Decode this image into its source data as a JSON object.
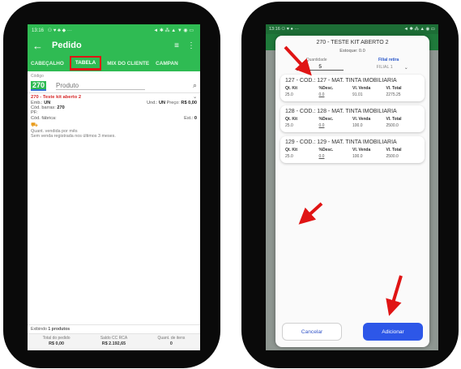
{
  "colors": {
    "accent": "#2fbb53",
    "highlight": "#e01414",
    "primary_button": "#2d57e8",
    "error_title": "#d62828",
    "arrow": "#e01414"
  },
  "left": {
    "status": {
      "time": "13:16",
      "icons": "⚇ ♥ ♣ ◆ ···",
      "right_icons": "◄ ✱ ⁂ ▲ ▼ ◉ ▭"
    },
    "appbar": {
      "title": "Pedido",
      "back_icon": "←",
      "filter_icon": "≡",
      "more_icon": "⋮"
    },
    "tabs": [
      "CABEÇALHO",
      "TABELA",
      "MIX DO CLIENTE",
      "CAMPAN"
    ],
    "search": {
      "label": "Código",
      "code": "270",
      "product_placeholder": "Produto"
    },
    "product": {
      "title": "270 - Teste kit aberto 2",
      "emb_label": "Emb.:",
      "emb_value": "UN",
      "und_label": "Und.:",
      "und_value": "UN",
      "preco_label": "Preço:",
      "preco_value": "R$ 0,00",
      "barras_label": "Cód. barras:",
      "barras_value": "270",
      "pf_label": "PF:",
      "fabrica_label": "Cód. fábrica:",
      "est_label": "Est.:",
      "est_value": "0",
      "vendas_label": "Quant. vendida por mês",
      "vendas_note": "Sem venda registrada nos últimos 3 meses."
    },
    "footer": {
      "count_prefix": "Exibindo",
      "count_value": "1 produtos",
      "total_label": "Total do pedido",
      "total_value": "R$ 0,00",
      "saldo_label": "Saldo CC RCA",
      "saldo_value": "R$ 2.192,65",
      "itens_label": "Quant. de itens",
      "itens_value": "0"
    }
  },
  "right": {
    "status": {
      "time": "13:16",
      "icons": "⚇ ♥ ● ···",
      "right_icons": "◄ ✱ ⁂ ▲ ◉ ▭"
    },
    "modal": {
      "title": "270 - TESTE KIT ABERTO 2",
      "estoque": "Estoque: 0.0",
      "qty_label": "Quantidade",
      "qty_value": "5",
      "filial_label": "Filial retira",
      "filial_value": "FILIAL 1",
      "cards": [
        {
          "title": "127 - COD.: 127 - MAT. TINTA IMOBILIARIA",
          "h1": "Qt. Kit",
          "h2": "%Desc.",
          "h3": "Vl. Venda",
          "h4": "Vl. Total",
          "kit": "25.0",
          "desc": "0.0",
          "venda": "91.01",
          "total": "2275.25"
        },
        {
          "title": "128 - COD.: 128 - MAT. TINTA IMOBILIARIA",
          "h1": "Qt. Kit",
          "h2": "%Desc.",
          "h3": "Vl. Venda",
          "h4": "Vl. Total",
          "kit": "25.0",
          "desc": "0.0",
          "venda": "100.0",
          "total": "2500.0"
        },
        {
          "title": "129 - COD.: 129 - MAT. TINTA IMOBILIARIA",
          "h1": "Qt. Kit",
          "h2": "%Desc.",
          "h3": "Vl. Venda",
          "h4": "Vl. Total",
          "kit": "25.0",
          "desc": "0.0",
          "venda": "100.0",
          "total": "2500.0"
        }
      ],
      "cancel_label": "Cancelar",
      "add_label": "Adicionar"
    }
  }
}
